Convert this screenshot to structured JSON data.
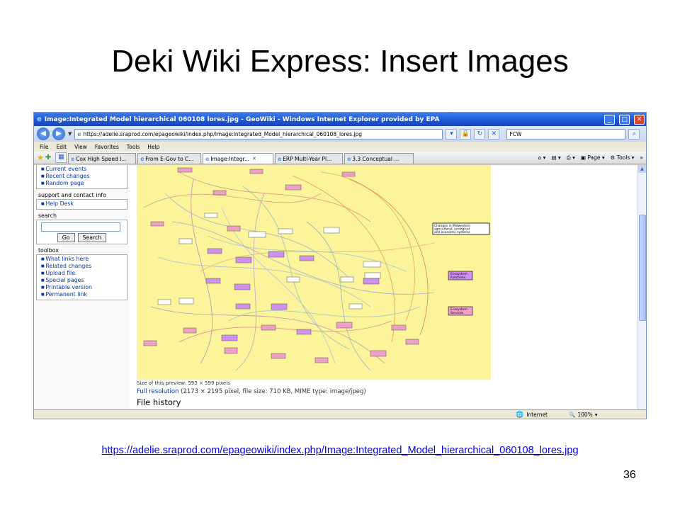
{
  "slide": {
    "title": "Deki Wiki Express: Insert Images",
    "source_link": "https://adelie.sraprod.com/epageowiki/index.php/Image:Integrated_Model_hierarchical_060108_lores.jpg",
    "page_number": "36"
  },
  "browser": {
    "window_title": "Image:Integrated Model hierarchical 060108 lores.jpg - GeoWiki - Windows Internet Explorer provided by EPA",
    "address": "https://adelie.sraprod.com/epageowiki/index.php/Image:Integrated_Model_hierarchical_060108_lores.jpg",
    "search_value": "FCW",
    "menu": [
      "File",
      "Edit",
      "View",
      "Favorites",
      "Tools",
      "Help"
    ],
    "tabs": [
      {
        "label": "Cox High Speed I..."
      },
      {
        "label": "From E-Gov to C..."
      },
      {
        "label": "Image:Integr...",
        "active": true
      },
      {
        "label": "ERP Multi-Year Pl..."
      },
      {
        "label": "3.3 Conceptual ..."
      }
    ],
    "command_bar": {
      "page": "Page",
      "tools": "Tools"
    },
    "status": {
      "zone": "Internet",
      "zoom": "100%"
    }
  },
  "sidebar": {
    "navigation_items": [
      "Current events",
      "Recent changes",
      "Random page"
    ],
    "support_heading": "support and contact info",
    "support_items": [
      "Help Desk"
    ],
    "search_heading": "search",
    "go_label": "Go",
    "search_label": "Search",
    "toolbox_heading": "toolbox",
    "toolbox_items": [
      "What links here",
      "Related changes",
      "Upload file",
      "Special pages",
      "Printable version",
      "Permanent link"
    ]
  },
  "image_page": {
    "preview_size": "Size of this preview: 593 × 599 pixels",
    "full_resolution_link": "Full resolution",
    "full_resolution_meta": " (2173 × 2195 pixel, file size: 710 KB, MIME type: image/jpeg)",
    "file_history_heading": "File history",
    "diagram_labels": [
      "Changes in Midwestern agricultural, ecological and economic systems",
      "Ecosystem Functions",
      "Ecosystem Services"
    ]
  },
  "icons": {
    "back": "back-arrow-icon",
    "forward": "forward-arrow-icon",
    "favorites": "star-icon",
    "add_favorite": "add-favorite-icon",
    "home": "home-icon",
    "print": "printer-icon",
    "globe": "globe-icon"
  },
  "colors": {
    "diagram_background": "#fbf49a",
    "titlebar": "#1b55d4",
    "link": "#0033aa"
  }
}
